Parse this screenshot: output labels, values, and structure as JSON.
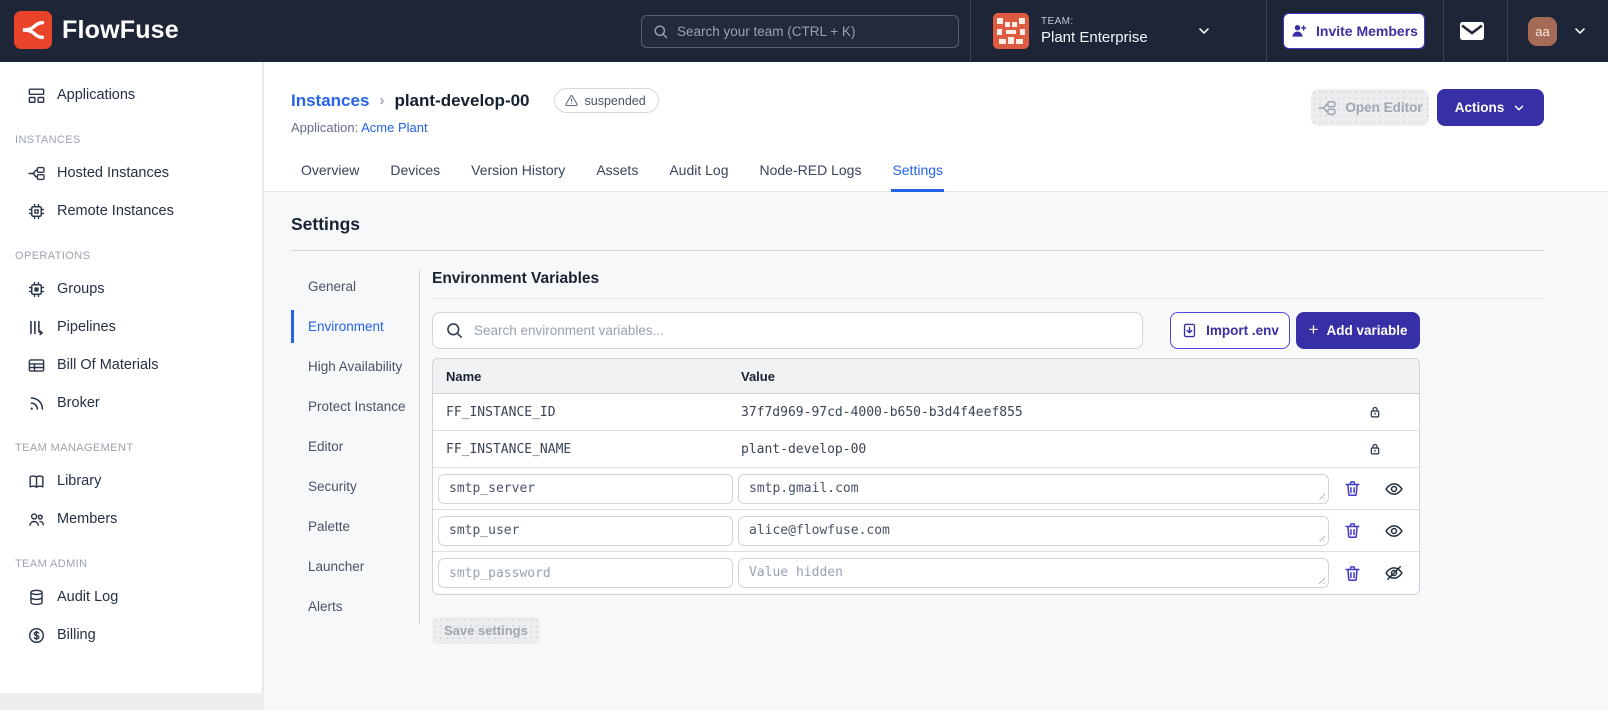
{
  "colors": {
    "navbar_bg": "#1D2536",
    "brand_red": "#E9442A",
    "primary_indigo": "#372FA6",
    "link_blue": "#2563EB",
    "content_bg": "#F7F8FA"
  },
  "navbar": {
    "brand": "FlowFuse",
    "search_placeholder": "Search your team (CTRL + K)",
    "team_label": "TEAM:",
    "team_name": "Plant Enterprise",
    "invite_label": "Invite Members",
    "user_initials": "aa"
  },
  "sidebar": {
    "sections": [
      {
        "items": [
          {
            "label": "Applications"
          }
        ]
      },
      {
        "header": "INSTANCES",
        "items": [
          {
            "label": "Hosted Instances"
          },
          {
            "label": "Remote Instances"
          }
        ]
      },
      {
        "header": "OPERATIONS",
        "items": [
          {
            "label": "Groups"
          },
          {
            "label": "Pipelines"
          },
          {
            "label": "Bill Of Materials"
          },
          {
            "label": "Broker"
          }
        ]
      },
      {
        "header": "TEAM MANAGEMENT",
        "items": [
          {
            "label": "Library"
          },
          {
            "label": "Members"
          }
        ]
      },
      {
        "header": "TEAM ADMIN",
        "items": [
          {
            "label": "Audit Log"
          },
          {
            "label": "Billing"
          }
        ]
      }
    ]
  },
  "header": {
    "breadcrumb_parent": "Instances",
    "breadcrumb_separator": "›",
    "breadcrumb_current": "plant-develop-00",
    "status_badge": "suspended",
    "application_label": "Application:",
    "application_link": "Acme Plant",
    "open_editor_label": "Open Editor",
    "actions_label": "Actions"
  },
  "tabs": {
    "items": [
      "Overview",
      "Devices",
      "Version History",
      "Assets",
      "Audit Log",
      "Node-RED Logs",
      "Settings"
    ],
    "active": "Settings"
  },
  "settings": {
    "title": "Settings",
    "nav": {
      "items": [
        "General",
        "Environment",
        "High Availability",
        "Protect Instance",
        "Editor",
        "Security",
        "Palette",
        "Launcher",
        "Alerts"
      ],
      "active": "Environment"
    },
    "env": {
      "title": "Environment Variables",
      "search_placeholder": "Search environment variables...",
      "import_label": "Import .env",
      "add_label": "Add variable",
      "plus_glyph": "+",
      "columns": {
        "name": "Name",
        "value": "Value"
      },
      "locked_rows": [
        {
          "name": "FF_INSTANCE_ID",
          "value": "37f7d969-97cd-4000-b650-b3d4f4eef855"
        },
        {
          "name": "FF_INSTANCE_NAME",
          "value": "plant-develop-00"
        }
      ],
      "editable_rows": [
        {
          "name": "smtp_server",
          "value": "smtp.gmail.com",
          "hidden": false
        },
        {
          "name": "smtp_user",
          "value": "alice@flowfuse.com",
          "hidden": false
        },
        {
          "name": "smtp_password",
          "value": "",
          "value_placeholder": "Value hidden",
          "hidden": true
        }
      ],
      "save_label": "Save settings"
    }
  }
}
